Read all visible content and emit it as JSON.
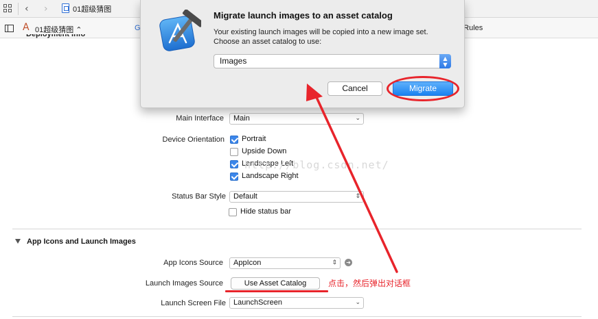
{
  "navbar": {
    "breadcrumb": "01超级猜图"
  },
  "tabbar": {
    "target_name": "01超级猜图 ⌃",
    "tab_left_fragment": "G",
    "tab_right_fragment": "d Rules"
  },
  "deployment": {
    "heading_fragment": "Deployment Info",
    "main_interface_label": "Main Interface",
    "main_interface_value": "Main",
    "device_orientation_label": "Device Orientation",
    "orientations": [
      {
        "label": "Portrait",
        "checked": true
      },
      {
        "label": "Upside Down",
        "checked": false
      },
      {
        "label": "Landscape Left",
        "checked": true
      },
      {
        "label": "Landscape Right",
        "checked": true
      }
    ],
    "status_bar_style_label": "Status Bar Style",
    "status_bar_style_value": "Default",
    "hide_status_bar_label": "Hide status bar"
  },
  "app_icons": {
    "section_title": "App Icons and Launch Images",
    "app_icons_source_label": "App Icons Source",
    "app_icons_source_value": "AppIcon",
    "launch_images_source_label": "Launch Images Source",
    "use_asset_catalog_label": "Use Asset Catalog",
    "launch_screen_file_label": "Launch Screen File",
    "launch_screen_file_value": "LaunchScreen"
  },
  "annotation": {
    "text": "点击，然后弹出对话框",
    "color": "#e8242b"
  },
  "watermark": "http://blog.csdn.net/",
  "dialog": {
    "title": "Migrate launch images to an asset catalog",
    "message": "Your existing launch images will be copied into a new image set. Choose an asset catalog to use:",
    "selected_catalog": "Images",
    "cancel_label": "Cancel",
    "migrate_label": "Migrate",
    "accent_color": "#1a82f1"
  },
  "icons": {
    "grid": "grid-icon",
    "back": "chevron-left-icon",
    "forward": "chevron-right-icon",
    "file": "file-icon",
    "sidebar": "sidebar-toggle-icon",
    "target": "app-target-icon",
    "go": "go-arrow-icon",
    "xcode": "xcode-hammer-icon"
  }
}
